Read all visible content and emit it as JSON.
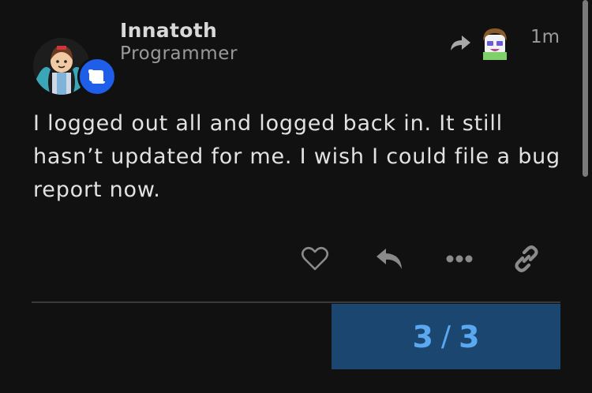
{
  "post": {
    "username": "Innatoth",
    "user_title": "Programmer",
    "timestamp": "1m",
    "body": "I logged out all and logged back in. It still hasn’t updated for me. I wish I could file a bug report now."
  },
  "progress": {
    "current": "3",
    "separator": "/",
    "total": "3"
  },
  "colors": {
    "background": "#111111",
    "badge": "#1f5ee8",
    "progress_bg": "#1b4670",
    "progress_text": "#5aa8f0"
  },
  "icons": {
    "actions": [
      "heart-icon",
      "reply-icon",
      "more-icon",
      "link-icon"
    ]
  }
}
